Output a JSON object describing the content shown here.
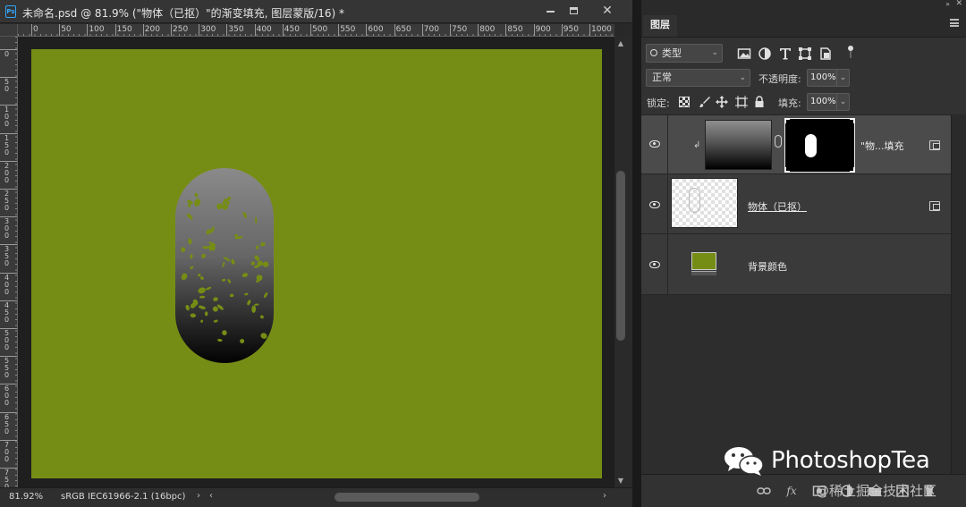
{
  "document": {
    "title": "未命名.psd @ 81.9% (\"物体（已抠）\"的渐变填充, 图层蒙版/16) *",
    "app_badge": "Ps",
    "window_controls": {
      "close": "✕"
    },
    "ruler_labels_h": [
      "0",
      "50",
      "100",
      "150",
      "200",
      "250",
      "300",
      "350",
      "400",
      "450",
      "500",
      "550",
      "600",
      "650",
      "700",
      "750",
      "800",
      "850",
      "900",
      "950",
      "1000"
    ],
    "ruler_labels_v": [
      "0",
      "50",
      "100",
      "150",
      "200",
      "250",
      "300",
      "350",
      "400",
      "450",
      "500",
      "550",
      "600",
      "650",
      "700",
      "750"
    ],
    "canvas_color": "#768d15",
    "status": {
      "zoom": "81.92%",
      "profile": "sRGB IEC61966-2.1 (16bpc)"
    }
  },
  "layers_panel": {
    "tab_label": "图层",
    "filter_kind": "类型",
    "blend_mode": "正常",
    "opacity_label": "不透明度:",
    "opacity_value": "100%",
    "lock_label": "锁定:",
    "fill_label": "填充:",
    "fill_value": "100%",
    "layers": [
      {
        "name": "\"物...填充",
        "selected": true,
        "visible": true
      },
      {
        "name": "物体（已抠）",
        "selected": false,
        "visible": true
      },
      {
        "name": "背景颜色",
        "selected": false,
        "visible": true
      }
    ],
    "footer_fx": "fx"
  },
  "watermark": {
    "brand": "PhotoshopTea",
    "credit": "@稀土掘金技术社区"
  },
  "colors": {
    "accent": "#31a8ff",
    "canvas": "#768d15"
  }
}
